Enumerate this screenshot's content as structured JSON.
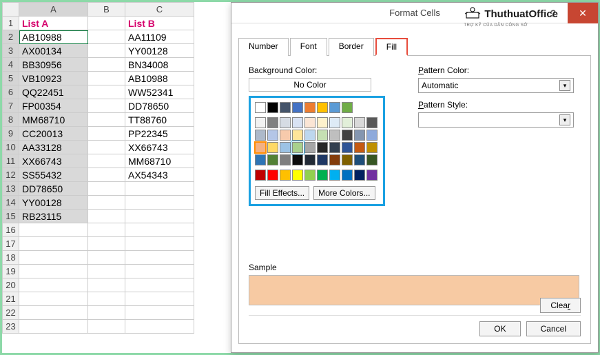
{
  "sheet": {
    "columns": [
      "A",
      "B",
      "C"
    ],
    "headers": {
      "A": "List A",
      "C": "List B"
    },
    "dataA": [
      "AB10988",
      "AX00134",
      "BB30956",
      "VB10923",
      "QQ22451",
      "FP00354",
      "MM68710",
      "CC20013",
      "AA33128",
      "XX66743",
      "SS55432",
      "DD78650",
      "YY00128",
      "RB23115"
    ],
    "dataC": [
      "AA11109",
      "YY00128",
      "BN34008",
      "AB10988",
      "WW52341",
      "DD78650",
      "TT88760",
      "PP22345",
      "XX66743",
      "MM68710",
      "AX54343"
    ],
    "empty_rows": [
      16,
      17,
      18,
      19,
      20,
      21,
      22,
      23
    ]
  },
  "dialog": {
    "title": "Format Cells",
    "tabs": [
      "Number",
      "Font",
      "Border",
      "Fill"
    ],
    "active_tab": "Fill",
    "bg_label": "Background Color:",
    "no_color": "No Color",
    "fill_effects": "Fill Effects...",
    "more_colors": "More Colors...",
    "pattern_color_label": "Pattern Color:",
    "pattern_color_value": "Automatic",
    "pattern_style_label": "Pattern Style:",
    "sample_label": "Sample",
    "clear": "Clear",
    "ok": "OK",
    "cancel": "Cancel",
    "help": "?",
    "sample_color": "#f7caa3",
    "logo": "ThuthuatOffice",
    "logo_sub": "TRỢ KỸ CỦA DÂN CÔNG SỞ"
  },
  "palette": {
    "top": [
      "#ffffff",
      "#000000",
      "#44546a",
      "#4472c4",
      "#ed7d31",
      "#ffc000",
      "#5b9bd5",
      "#70ad47"
    ],
    "r1": [
      "#f2f2f2",
      "#808080",
      "#d6dce4",
      "#d9e2f3",
      "#fbe5d5",
      "#fff2cc",
      "#deebf6",
      "#e2efd9"
    ],
    "r2": [
      "#d9d9d9",
      "#595959",
      "#adb9ca",
      "#b4c6e7",
      "#f7caac",
      "#fee599",
      "#bdd7ee",
      "#c5e0b3"
    ],
    "r3": [
      "#bfbfbf",
      "#404040",
      "#8496b0",
      "#8eaadb",
      "#f4b183",
      "#ffd965",
      "#9cc3e5",
      "#a8d08d"
    ],
    "r4": [
      "#a6a6a6",
      "#262626",
      "#323f4f",
      "#2f5496",
      "#c55a11",
      "#bf9000",
      "#2e75b5",
      "#538135"
    ],
    "r5": [
      "#7f7f7f",
      "#0d0d0d",
      "#222a35",
      "#1f3864",
      "#833c0b",
      "#7f6000",
      "#1e4e79",
      "#375623"
    ],
    "std": [
      "#c00000",
      "#ff0000",
      "#ffc000",
      "#ffff00",
      "#92d050",
      "#00b050",
      "#00b0f0",
      "#0070c0",
      "#002060",
      "#7030a0"
    ]
  }
}
